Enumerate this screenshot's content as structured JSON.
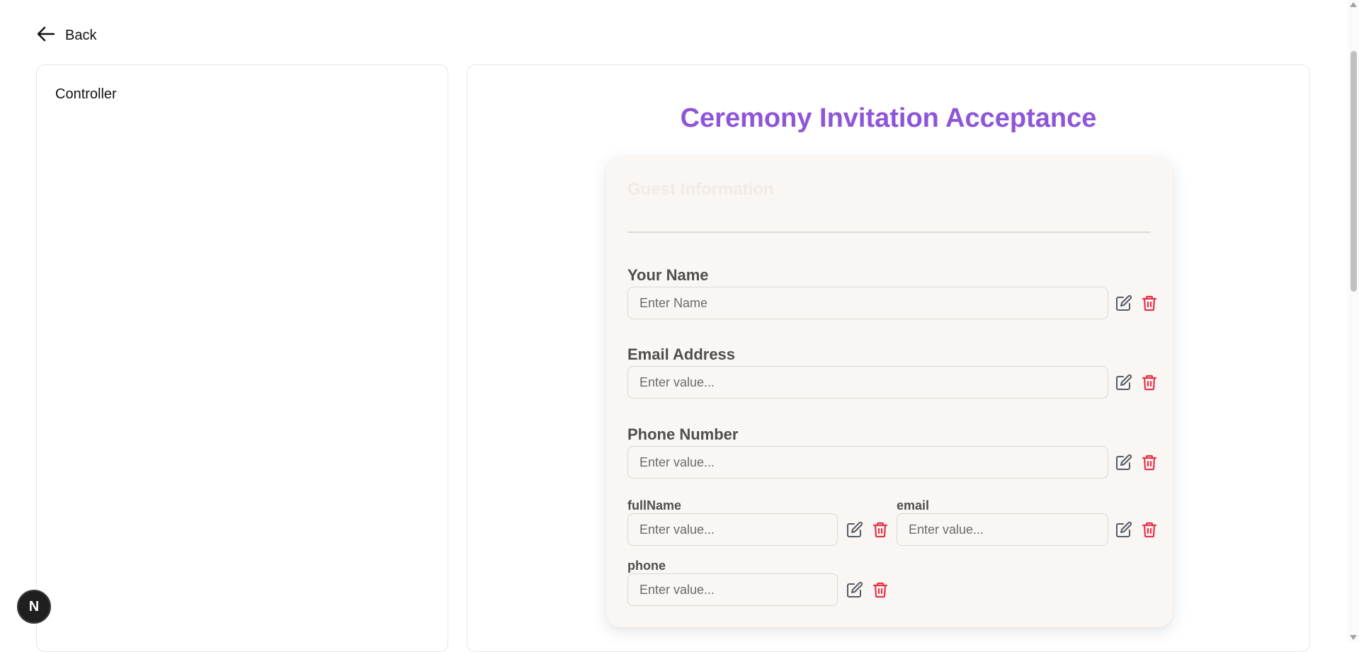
{
  "nav": {
    "back_label": "Back"
  },
  "controller": {
    "title": "Controller"
  },
  "form": {
    "title": "Ceremony Invitation Acceptance",
    "section_title": "Guest Information",
    "fields": {
      "your_name": {
        "label": "Your Name",
        "placeholder": "Enter Name",
        "value": ""
      },
      "email_address": {
        "label": "Email Address",
        "placeholder": "Enter value...",
        "value": ""
      },
      "phone_number": {
        "label": "Phone Number",
        "placeholder": "Enter value...",
        "value": ""
      },
      "full_name": {
        "label": "fullName",
        "placeholder": "Enter value...",
        "value": ""
      },
      "email": {
        "label": "email",
        "placeholder": "Enter value...",
        "value": ""
      },
      "phone": {
        "label": "phone",
        "placeholder": "Enter value...",
        "value": ""
      }
    }
  },
  "badge": {
    "letter": "N"
  },
  "colors": {
    "accent": "#8f55d9",
    "delete": "#e5334a",
    "edit": "#555b66",
    "card_bg": "#faf6f3"
  },
  "icons": {
    "back": "arrow-left-icon",
    "edit": "edit-icon",
    "delete": "trash-icon"
  }
}
